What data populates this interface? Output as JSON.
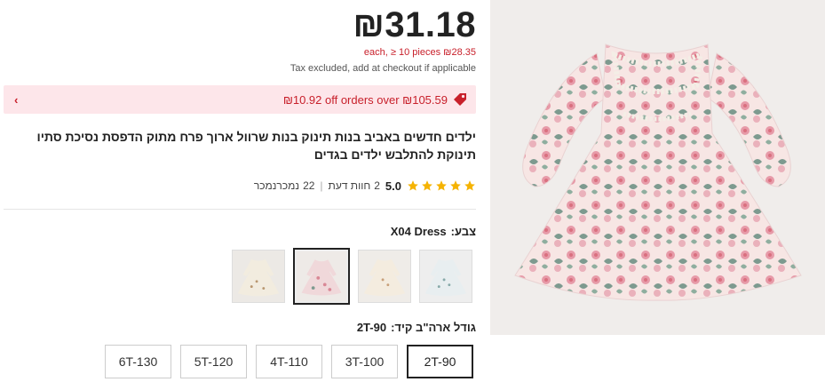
{
  "price": {
    "main": "₪31.18",
    "tier": "each, ≥ 10 pieces ₪28.35",
    "tax": "Tax excluded, add at checkout if applicable"
  },
  "coupon": {
    "text": "₪10.92 off orders over ₪105.59",
    "icon": "tag-icon",
    "chevron": "chevron-left-icon"
  },
  "product": {
    "title": "ילדים חדשים באביב בנות תינוק בנות שרוול ארוך פרח מתוק הדפסת נסיכת סתיו תינוקת להתלבש ילדים בגדים"
  },
  "rating": {
    "score": "5.0",
    "stars": 5,
    "reviews_count": "2",
    "reviews_label": "חוות דעת",
    "sold_count": "22",
    "sold_label": "נמכרנמכר"
  },
  "color": {
    "label": "צבע:",
    "value": "X04 Dress",
    "options": [
      "X01",
      "X02",
      "X03",
      "X04"
    ],
    "selected_index": 1
  },
  "size": {
    "label": "גודל ארה\"ב קיד:",
    "value": "2T-90",
    "options": [
      "2T-90",
      "3T-100",
      "4T-110",
      "5T-120",
      "6T-130"
    ],
    "selected_index": 0
  },
  "colors": {
    "accent": "#c8202b",
    "coupon_bg": "#fde6ea",
    "star": "#f5b301"
  }
}
